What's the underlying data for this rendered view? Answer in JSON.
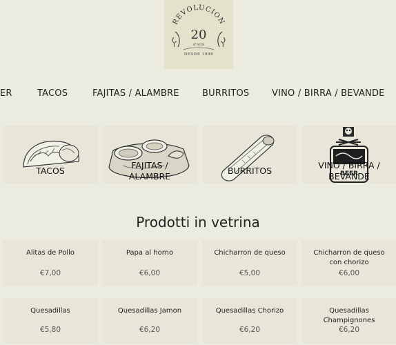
{
  "logo": {
    "top_text": "REVOLUCION",
    "number": "20",
    "subtitle": "A'NOS",
    "since": "DESDE 1998"
  },
  "nav": [
    "ER",
    "TACOS",
    "FAJITAS / ALAMBRE",
    "BURRITOS",
    "VINO / BIRRA / BEVANDE"
  ],
  "categories": [
    {
      "label1": "TACOS",
      "label2": ""
    },
    {
      "label1": "FAJITAS /",
      "label2": "ALAMBRE"
    },
    {
      "label1": "BURRITOS",
      "label2": ""
    },
    {
      "label1": "VINO / BIRRA /",
      "label2": "BEVANDE"
    }
  ],
  "bottle_label": "BEER",
  "section_title": "Prodotti in vetrina",
  "products": [
    {
      "name1": "Alitas de Pollo",
      "name2": "",
      "price": "€7,00"
    },
    {
      "name1": "Papa al horno",
      "name2": "",
      "price": "€6,00"
    },
    {
      "name1": "Chicharron de queso",
      "name2": "",
      "price": "€5,00"
    },
    {
      "name1": "Chicharron de queso",
      "name2": "con chorizo",
      "price": "€6,00"
    },
    {
      "name1": "Quesadillas",
      "name2": "",
      "price": "€5,80"
    },
    {
      "name1": "Quesadillas Jamon",
      "name2": "",
      "price": "€6,20"
    },
    {
      "name1": "Quesadillas Chorizo",
      "name2": "",
      "price": "€6,20"
    },
    {
      "name1": "Quesadillas",
      "name2": "Champignones",
      "price": "€6,20"
    }
  ]
}
